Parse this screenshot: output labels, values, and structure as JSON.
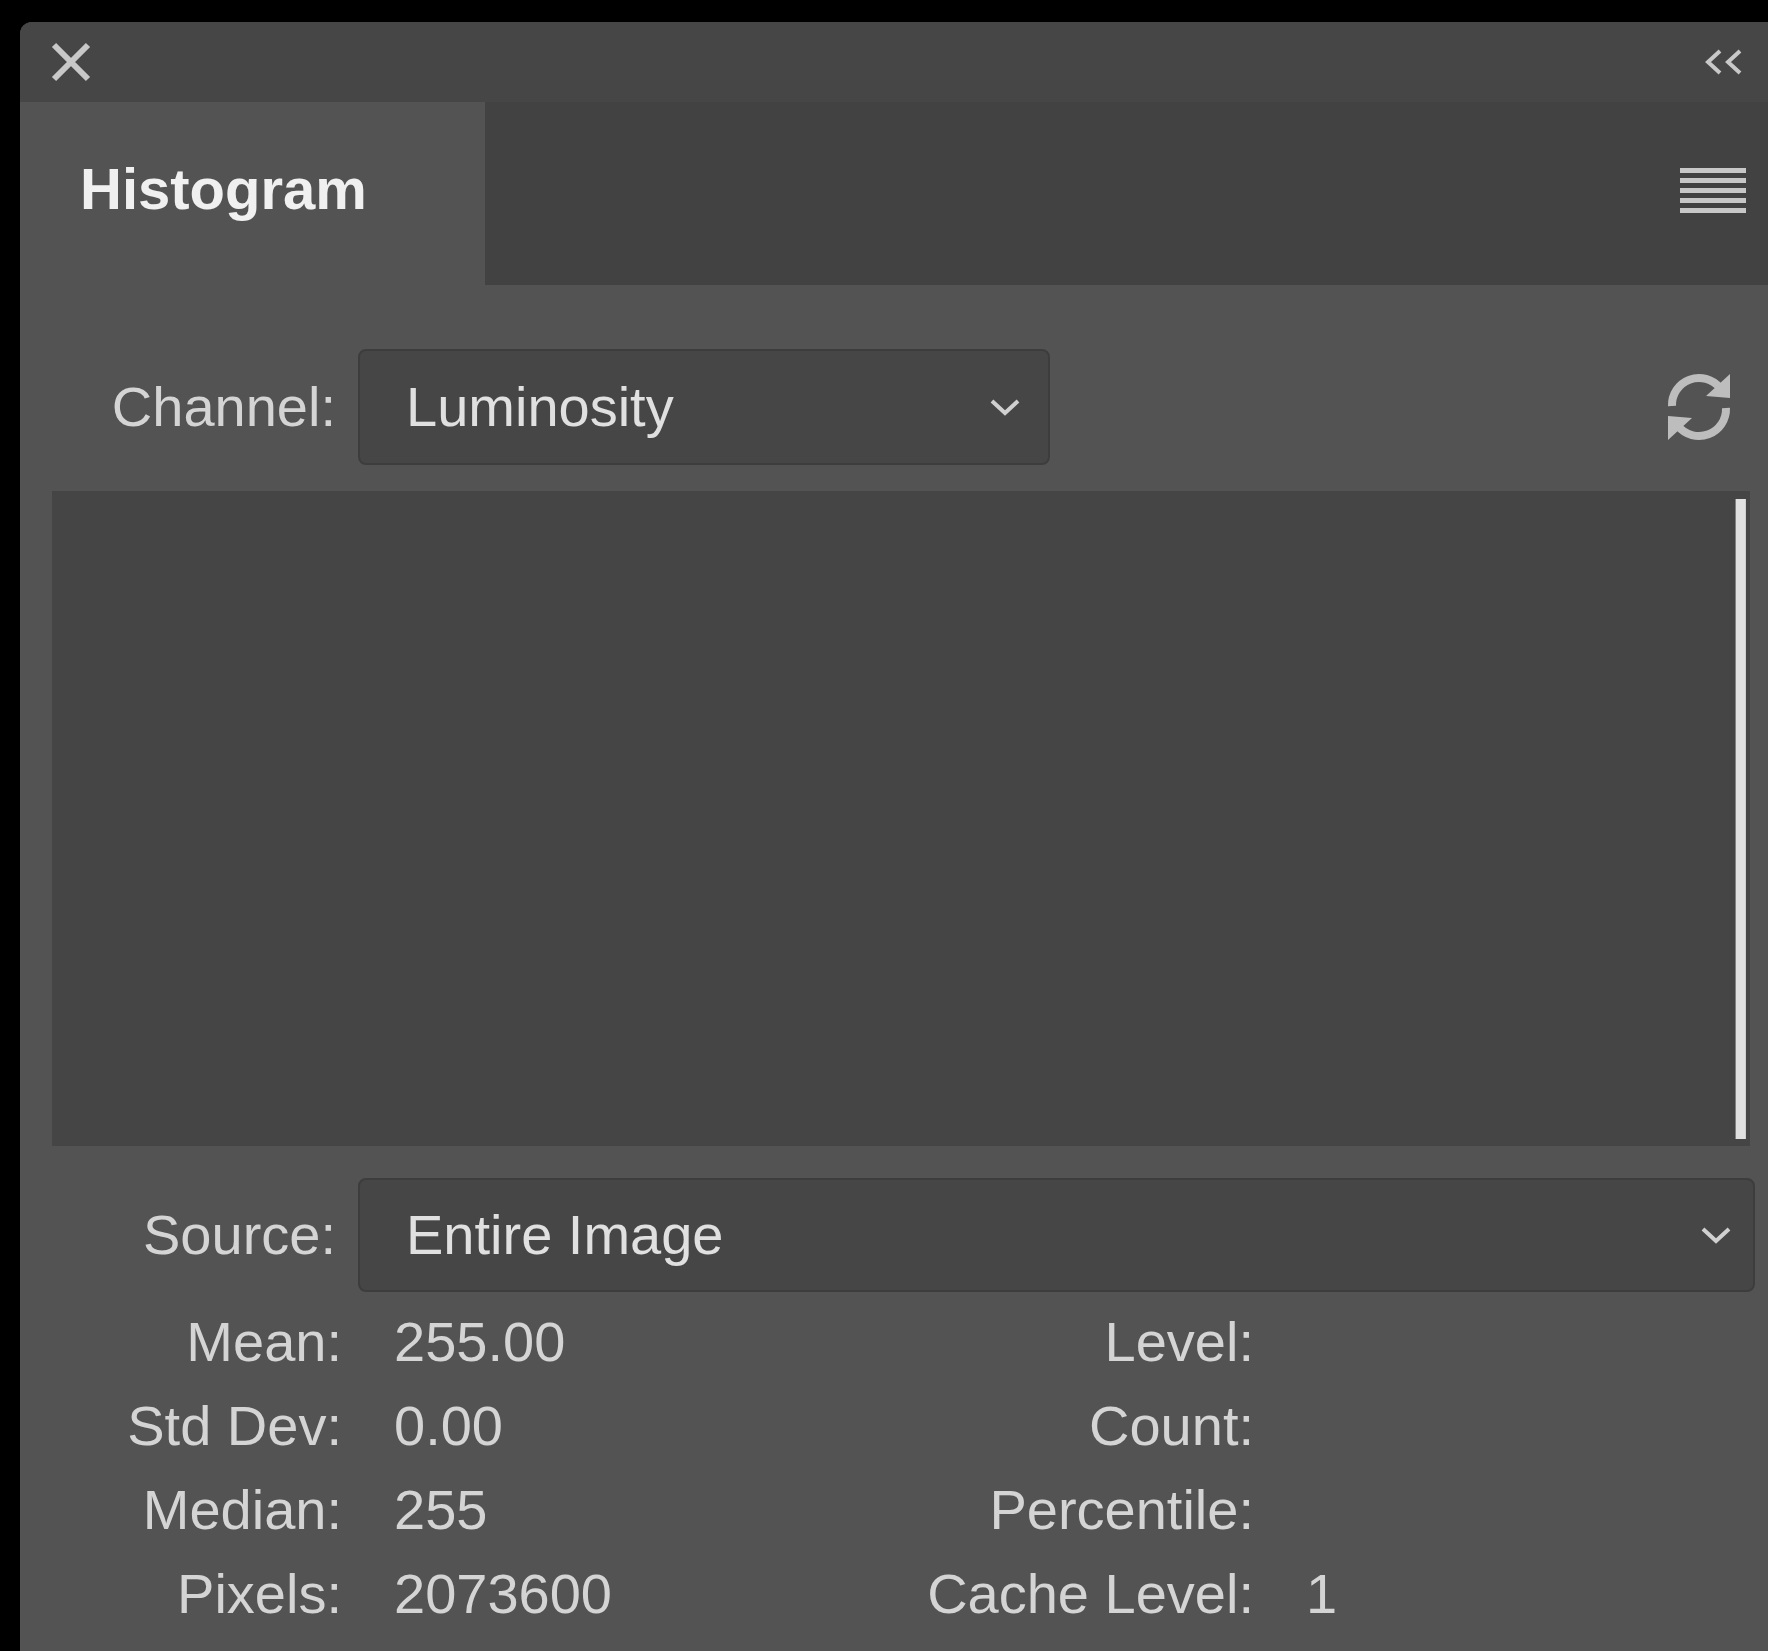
{
  "tabs": [
    {
      "label": "Histogram",
      "selected": true
    }
  ],
  "channel": {
    "label": "Channel:",
    "value": "Luminosity"
  },
  "source": {
    "label": "Source:",
    "value": "Entire Image"
  },
  "stats_left": [
    {
      "label": "Mean:",
      "value": "255.00"
    },
    {
      "label": "Std Dev:",
      "value": "0.00"
    },
    {
      "label": "Median:",
      "value": "255"
    },
    {
      "label": "Pixels:",
      "value": "2073600"
    }
  ],
  "stats_right": [
    {
      "label": "Level:"
    },
    {
      "label": "Count:"
    },
    {
      "label": "Percentile:"
    },
    {
      "label": "Cache Level:",
      "value": "1"
    }
  ]
}
